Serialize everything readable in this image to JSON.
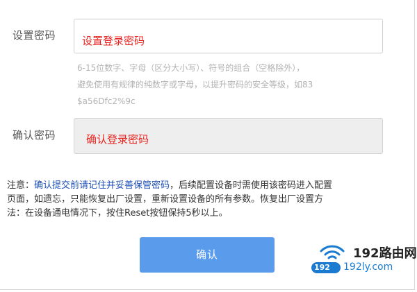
{
  "form": {
    "password_label": "设置密码",
    "password_value": "设置登录密码",
    "hint_lines": [
      "6-15位数字、字母（区分大小写）、符号的组合（空格除外），",
      "避免使用有规律的纯数字或字母，以提升密码的安全等级，如83",
      "$a56Dfc2%9c"
    ],
    "confirm_label": "确认密码",
    "confirm_value": "确认登录密码"
  },
  "note": {
    "prefix": "注意：",
    "highlight": "确认提交前请记住并妥善保管密码",
    "line1_rest": "，后续配置设备时需使用该密码进入配置",
    "line2": "页面，如遗忘，只能恢复出厂设置，重新设置设备的所有参数。恢复出厂设置方",
    "line3": "法：在设备通电情况下，按住Reset按钮保持5秒以上。"
  },
  "buttons": {
    "confirm_label": "确认"
  },
  "watermark": {
    "name": "192路由网",
    "domain": "192ly.com",
    "badge": "192"
  },
  "colors": {
    "accent_button": "#5b9bec",
    "input_text": "#e8231f",
    "note_highlight": "#1d4fb3",
    "logo_blue": "#1a7bd1"
  }
}
